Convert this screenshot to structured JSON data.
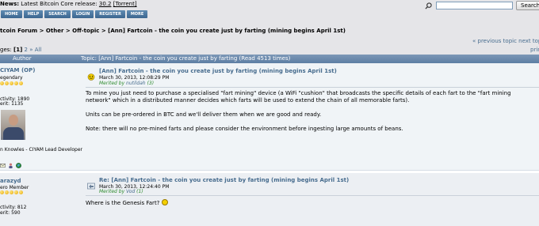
{
  "news": {
    "prefix": "News:",
    "text": "Latest Bitcoin Core release:",
    "version": "30.2",
    "torrent": "[Torrent]"
  },
  "search": {
    "value": "",
    "button": "Search"
  },
  "nav": [
    "HOME",
    "HELP",
    "SEARCH",
    "LOGIN",
    "REGISTER",
    "MORE"
  ],
  "breadcrumb": {
    "forum": "tcoin Forum",
    "sep": " > ",
    "cat": "Other",
    "board": "Off-topic",
    "topic": "[Ann] Fartcoin - the coin you create just by farting (mining begins April 1st)"
  },
  "topic_nav": {
    "prev": "« previous topic",
    "next": "next topi",
    "print": "prin"
  },
  "pages": {
    "label": "ges:",
    "current": "[1]",
    "second": "2",
    "all": "All",
    "arrow": "»"
  },
  "catbar": {
    "author": "Author",
    "topic": "Topic: [Ann] Fartcoin - the coin you create just by farting  (Read 4513 times)"
  },
  "post1": {
    "user": "CIYAM (OP)",
    "rank": "egendary",
    "activity": "ctivity: 1890",
    "merit": "erit: 1135",
    "signature": "n Knowles - CIYAM Lead Developer",
    "title": "[Ann] Fartcoin - the coin you create just by farting (mining begins April 1st)",
    "date": "March 30, 2013, 12:08:29 PM",
    "mention_prefix": "Merited by ",
    "mention_user": "nutildah",
    "mention_count": " (3)",
    "paragraphs": [
      "To mine you just need to purchase a specialised \"fart mining\" device (a WiFi \"cushion\" that broadcasts the specific details of each fart to the \"fart mining network\" which in a distributed manner decides which farts will be used to extend the chain of all memorable farts).",
      "Units can be pre-ordered in BTC and we'll deliver them when we are good and ready.",
      "Note: there will no pre-mined farts and please consider the environment before ingesting large amounts of beans."
    ]
  },
  "post2": {
    "user": "arazyd",
    "rank": "ero Member",
    "activity": "ctivity: 812",
    "merit": "erit: 590",
    "title": "Re: [Ann] Fartcoin - the coin you create just by farting (mining begins April 1st)",
    "date": "March 30, 2013, 12:24:40 PM",
    "mention_prefix": "Merited by ",
    "mention_user": "Vod",
    "mention_count": " (1)",
    "body": "Where is the Genesis Fart?"
  }
}
